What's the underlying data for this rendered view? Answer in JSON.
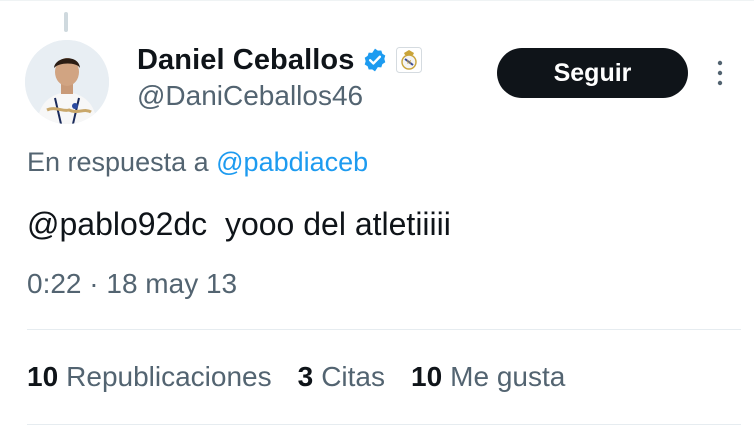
{
  "colors": {
    "accent": "#1d9bf0",
    "text": "#0f1419",
    "secondary": "#536471",
    "button_bg": "#0f1419",
    "button_text": "#ffffff",
    "verified": "#1d9bf0"
  },
  "author": {
    "display_name": "Daniel Ceballos",
    "handle": "@DaniCeballos46",
    "verified_icon": "verified-badge-icon",
    "affiliate_icon": "club-crest-icon"
  },
  "follow_button": {
    "label": "Seguir"
  },
  "tweet": {
    "reply_prefix": "En respuesta a",
    "reply_to": "@pabdiaceb",
    "text": "@pablo92dc  yooo del atletiiiii",
    "timestamp": "0:22 · 18 may 13"
  },
  "stats": [
    {
      "count": "10",
      "label": "Republicaciones"
    },
    {
      "count": "3",
      "label": "Citas"
    },
    {
      "count": "10",
      "label": "Me gusta"
    }
  ]
}
